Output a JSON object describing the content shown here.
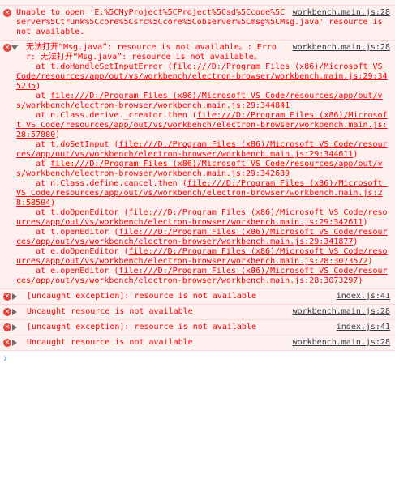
{
  "messages": [
    {
      "source": "workbench.main.js:28",
      "text": "Unable to open 'E:%5CMyProject%5CProject%5Csd%5Ccode%5Cserver%5Ctrunk%5Ccore%5Csrc%5Ccore%5Cobserver%5Cmsg%5CMsg.java' resource is not available."
    },
    {
      "source": "workbench.main.js:28",
      "head": "无法打开“Msg.java”: resource is not available。: Error: 无法打开“Msg.java”: resource is not available。",
      "stack": [
        {
          "pre": "    at t.doHandleSetInputError (",
          "link": "file:///D:/Program Files (x86)/Microsoft VS Code/resources/app/out/vs/workbench/electron-browser/workbench.main.js:29:345235",
          "post": ")"
        },
        {
          "pre": "    at ",
          "link": "file:///D:/Program Files (x86)/Microsoft VS Code/resources/app/out/vs/workbench/electron-browser/workbench.main.js:29:344841",
          "post": ""
        },
        {
          "pre": "    at n.Class.derive._creator.then (",
          "link": "file:///D:/Program Files (x86)/Microsoft VS Code/resources/app/out/vs/workbench/electron-browser/workbench.main.js:28:57880",
          "post": ")"
        },
        {
          "pre": "    at t.doSetInput (",
          "link": "file:///D:/Program Files (x86)/Microsoft VS Code/resources/app/out/vs/workbench/electron-browser/workbench.main.js:29:344611",
          "post": ")"
        },
        {
          "pre": "    at ",
          "link": "file:///D:/Program Files (x86)/Microsoft VS Code/resources/app/out/vs/workbench/electron-browser/workbench.main.js:29:342639",
          "post": ""
        },
        {
          "pre": "    at n.Class.define.cancel.then (",
          "link": "file:///D:/Program Files (x86)/Microsoft VS Code/resources/app/out/vs/workbench/electron-browser/workbench.main.js:28:58504",
          "post": ")"
        },
        {
          "pre": "    at t.doOpenEditor (",
          "link": "file:///D:/Program Files (x86)/Microsoft VS Code/resources/app/out/vs/workbench/electron-browser/workbench.main.js:29:342611",
          "post": ")"
        },
        {
          "pre": "    at t.openEditor (",
          "link": "file:///D:/Program Files (x86)/Microsoft VS Code/resources/app/out/vs/workbench/electron-browser/workbench.main.js:29:341877",
          "post": ")"
        },
        {
          "pre": "    at e.doOpenEditor (",
          "link": "file:///D:/Program Files (x86)/Microsoft VS Code/resources/app/out/vs/workbench/electron-browser/workbench.main.js:28:3073572",
          "post": ")"
        },
        {
          "pre": "    at e.openEditor (",
          "link": "file:///D:/Program Files (x86)/Microsoft VS Code/resources/app/out/vs/workbench/electron-browser/workbench.main.js:28:3073297",
          "post": ")"
        }
      ]
    },
    {
      "source": "index.js:41",
      "text": "[uncaught exception]: resource is not available"
    },
    {
      "source": "workbench.main.js:28",
      "text": "Uncaught resource is not available"
    },
    {
      "source": "index.js:41",
      "text": "[uncaught exception]: resource is not available"
    },
    {
      "source": "workbench.main.js:28",
      "text": "Uncaught resource is not available"
    }
  ],
  "icons": {
    "error": "error-circle-icon",
    "expand": "expand-triangle-icon",
    "prompt": "prompt-chevron-icon"
  },
  "colors": {
    "error_text": "#ff0000",
    "error_bg": "#fff0f0",
    "error_border": "#ffd6d6",
    "icon_red": "#e8403a",
    "link": "#303942",
    "prompt": "#1a73e8"
  },
  "console": {
    "prompt_glyph": "›"
  }
}
